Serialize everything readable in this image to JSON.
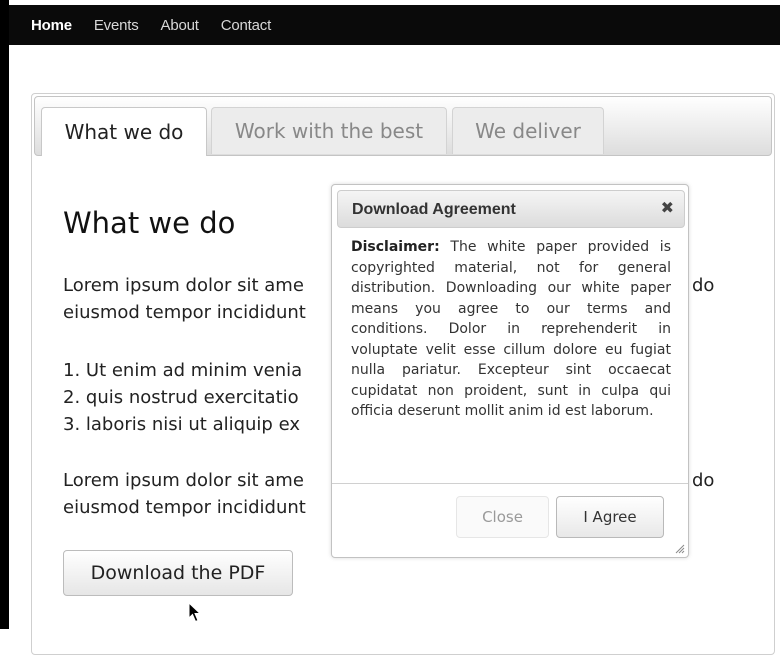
{
  "navbar": {
    "items": [
      {
        "label": "Home"
      },
      {
        "label": "Events"
      },
      {
        "label": "About"
      },
      {
        "label": "Contact"
      }
    ]
  },
  "tabs": {
    "items": [
      {
        "label": "What we do",
        "active": true
      },
      {
        "label": "Work with the best",
        "active": false
      },
      {
        "label": "We deliver",
        "active": false
      }
    ]
  },
  "content": {
    "heading": "What we do",
    "paragraph1_line1": "Lorem ipsum dolor sit ame",
    "paragraph1_line1_end": "do",
    "paragraph1_line2": "eiusmod tempor incididunt",
    "list": [
      "1. Ut enim ad minim venia",
      "2. quis nostrud exercitatio",
      "3. laboris nisi ut aliquip ex"
    ],
    "paragraph2_line1": "Lorem ipsum dolor sit ame",
    "paragraph2_line1_end": "do",
    "paragraph2_line2": "eiusmod tempor incididunt",
    "download_button": "Download the PDF"
  },
  "dialog": {
    "title": "Download Agreement",
    "close_icon": "close-icon",
    "disclaimer_label": "Disclaimer:",
    "disclaimer_text": "The white paper provided is copyrighted material, not for general distribution. Downloading our white paper means you agree to our terms and conditions. Dolor in reprehenderit in voluptate velit esse cillum dolore eu fugiat nulla pariatur. Excepteur sint occaecat cupidatat non proident, sunt in culpa qui officia deserunt mollit anim id est laborum.",
    "close_button": "Close",
    "agree_button": "I Agree"
  },
  "icons": {
    "cursor": "mouse-pointer-icon",
    "resize": "resize-grip-icon"
  }
}
